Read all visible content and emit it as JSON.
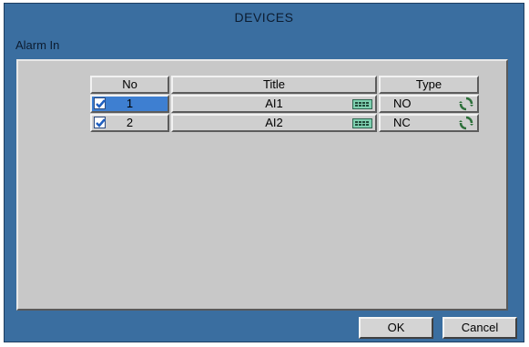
{
  "window": {
    "title": "DEVICES"
  },
  "section": {
    "label": "Alarm In"
  },
  "table": {
    "headers": {
      "no": "No",
      "title": "Title",
      "type": "Type"
    },
    "rows": [
      {
        "checked": true,
        "no": "1",
        "title": "AI1",
        "type": "NO",
        "selected": true
      },
      {
        "checked": true,
        "no": "2",
        "title": "AI2",
        "type": "NC",
        "selected": false
      }
    ]
  },
  "buttons": {
    "ok": "OK",
    "cancel": "Cancel"
  },
  "icons": {
    "checkbox": "checkmark-icon",
    "keyboard": "keyboard-icon",
    "type_toggle": "cycle-icon"
  },
  "colors": {
    "window_bg": "#3a6ea0",
    "panel_bg": "#c8c8c8",
    "selected_cell": "#3e7fd1"
  }
}
